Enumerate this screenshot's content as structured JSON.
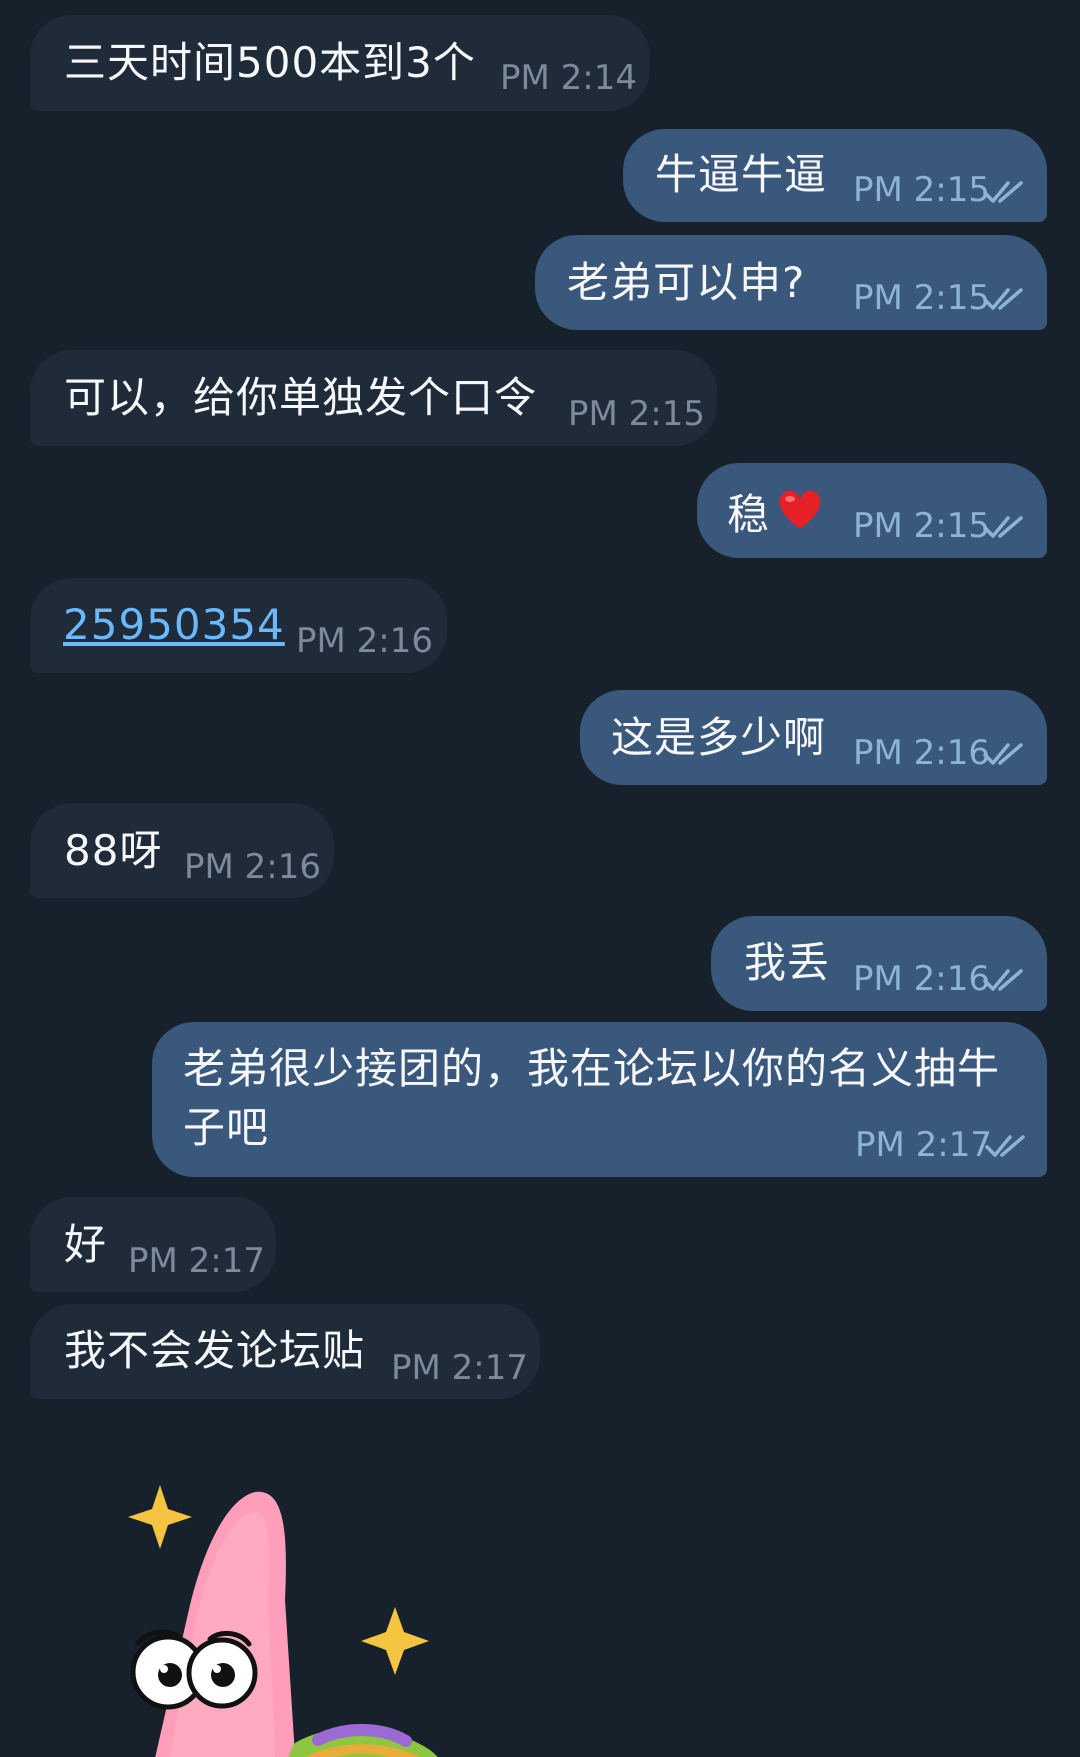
{
  "messages": [
    {
      "text": "三天时间500本到3个",
      "time": "PM 2:14"
    },
    {
      "text": "牛逼牛逼",
      "time": "PM 2:15"
    },
    {
      "text": "老弟可以申?",
      "time": "PM 2:15"
    },
    {
      "text": "可以，给你单独发个口令",
      "time": "PM 2:15"
    },
    {
      "text": "稳",
      "time": "PM 2:15"
    },
    {
      "text": "25950354",
      "time": "PM 2:16"
    },
    {
      "text": "这是多少啊",
      "time": "PM 2:16"
    },
    {
      "text": "88呀",
      "time": "PM 2:16"
    },
    {
      "text": "我丢",
      "time": "PM 2:16"
    },
    {
      "text": "老弟很少接团的，我在论坛以你的名义抽牛",
      "text2": "子吧",
      "time": "PM 2:17"
    },
    {
      "text": "好",
      "time": "PM 2:17"
    },
    {
      "text": "我不会发论坛贴",
      "time": "PM 2:17"
    }
  ],
  "icons": {
    "read_receipt": "double-check-icon",
    "emoji": "heart-icon",
    "sticker": "patrick-star-sticker"
  },
  "colors": {
    "background": "#17212b",
    "incoming_bubble": "#1f2b38",
    "outgoing_bubble": "#3a587b",
    "link": "#69b9ff",
    "read_check": "#8db4d8"
  }
}
